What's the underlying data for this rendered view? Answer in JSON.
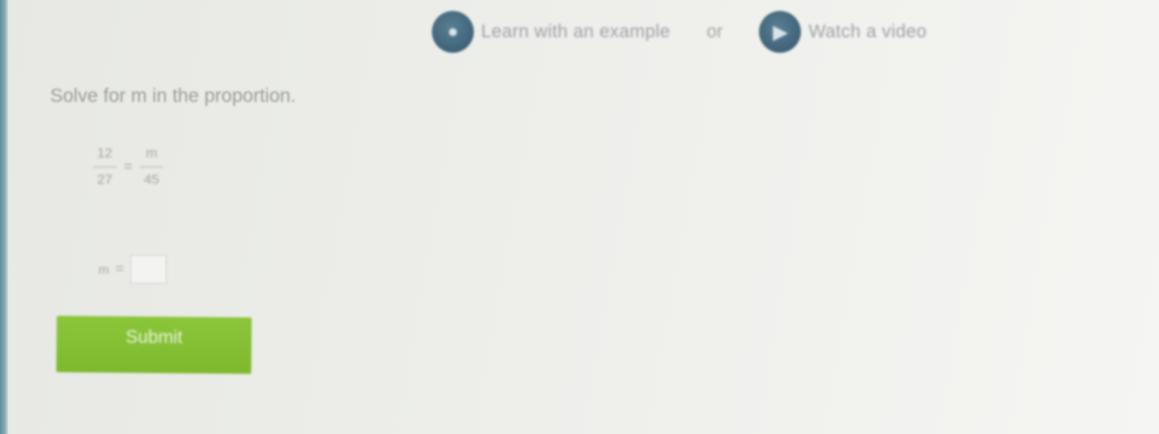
{
  "help": {
    "example": {
      "label": "Learn with an example",
      "icon": "lightbulb-icon"
    },
    "separator": "or",
    "video": {
      "label": "Watch a video",
      "icon": "play-icon"
    }
  },
  "question": {
    "prompt": "Solve for m in the proportion.",
    "equation": {
      "left_numerator": "12",
      "left_denominator": "27",
      "equals": "=",
      "right_numerator": "m",
      "right_denominator": "45"
    }
  },
  "answer": {
    "variable": "m",
    "equals": "=",
    "value": ""
  },
  "submit": {
    "label": "Submit"
  },
  "colors": {
    "submit_green": "#7fba32",
    "icon_blue": "#3e6378",
    "background": "#ecede9"
  }
}
